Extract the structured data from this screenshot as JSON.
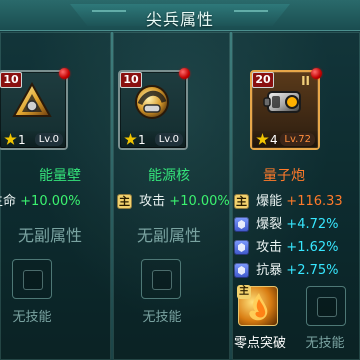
{
  "header": {
    "title": "尖兵属性"
  },
  "columns": [
    {
      "card": {
        "level": "10",
        "stars": "1",
        "lv": "Lv.0",
        "frame": "gray",
        "icon": "energy-wall"
      },
      "name": "能量壁",
      "stats": [
        {
          "label": "生命",
          "value": "+10.00%",
          "tag": "none",
          "value_color": "green"
        }
      ],
      "no_sub_attr": "无副属性",
      "skill": {
        "type": "empty",
        "label": "无技能"
      }
    },
    {
      "card": {
        "level": "10",
        "stars": "1",
        "lv": "Lv.0",
        "frame": "gray",
        "icon": "energy-core"
      },
      "name": "能源核",
      "stats": [
        {
          "tag": "主",
          "label": "攻击",
          "value": "+10.00%",
          "value_color": "green"
        }
      ],
      "no_sub_attr": "无副属性",
      "skill": {
        "type": "empty",
        "label": "无技能"
      }
    },
    {
      "card": {
        "level": "20",
        "stars": "4",
        "lv": "Lv.72",
        "frame": "gold",
        "badge": "II",
        "icon": "quantum-cannon"
      },
      "name": "量子炮",
      "stats": [
        {
          "tag": "主",
          "label": "爆能",
          "value": "+116.33",
          "value_color": "orange"
        },
        {
          "tag": "sub",
          "label": "爆裂",
          "value": "+4.72%",
          "value_color": "cyan"
        },
        {
          "tag": "sub",
          "label": "攻击",
          "value": "+1.62%",
          "value_color": "cyan"
        },
        {
          "tag": "sub",
          "label": "抗暴",
          "value": "+2.75%",
          "value_color": "cyan"
        }
      ],
      "skill": {
        "type": "active",
        "tag": "主",
        "label": "零点突破"
      }
    },
    {
      "skill": {
        "type": "empty",
        "label": "无技能"
      }
    }
  ],
  "colors": {
    "header_bg": "#1f5a5c",
    "green": "#3bf26f",
    "orange": "#ff7a2a",
    "cyan": "#37e7ff",
    "muted": "#7aa3a1"
  }
}
